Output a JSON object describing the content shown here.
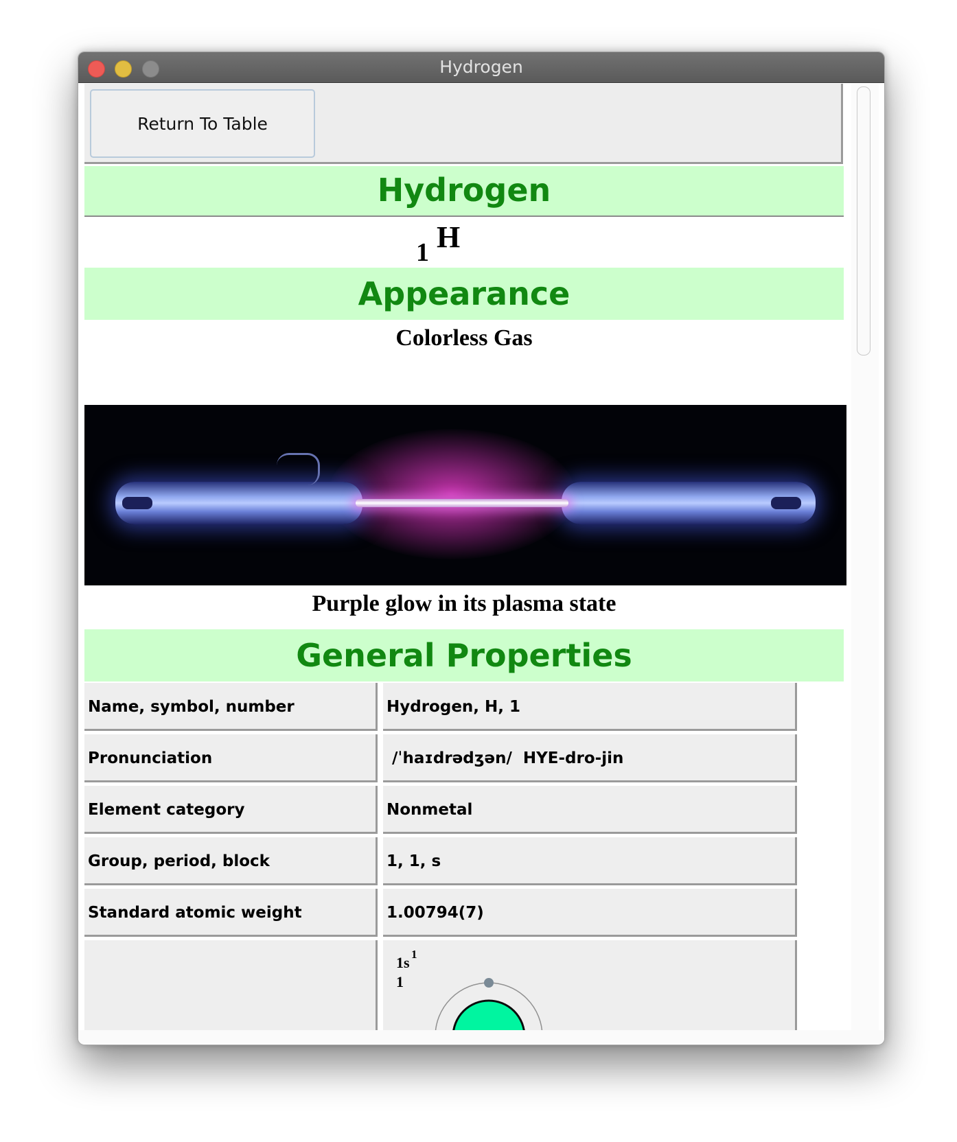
{
  "window": {
    "title": "Hydrogen"
  },
  "toolbar": {
    "return_label": "Return To Table"
  },
  "element": {
    "name": "Hydrogen",
    "atomic_number": "1",
    "symbol": "H"
  },
  "appearance": {
    "heading": "Appearance",
    "description": "Colorless Gas",
    "caption": "Purple glow in its plasma state"
  },
  "general": {
    "heading": "General Properties",
    "rows": [
      {
        "key": "Name, symbol, number",
        "value": "Hydrogen, H, 1"
      },
      {
        "key": "Pronunciation",
        "value": " /ˈhaɪdrədʒən/  HYE-dro-jin"
      },
      {
        "key": "Element category",
        "value": "Nonmetal"
      },
      {
        "key": "Group, period, block",
        "value": "1, 1, s"
      },
      {
        "key": "Standard atomic weight",
        "value": "1.00794(7)"
      }
    ]
  },
  "electron_config": {
    "orbital": "1s",
    "superscript": "1",
    "shell_count": "1"
  },
  "colors": {
    "heading_band": "#ccffcc",
    "heading_text": "#118811",
    "nucleus": "#00f5a0",
    "electron": "#7a8a96"
  }
}
